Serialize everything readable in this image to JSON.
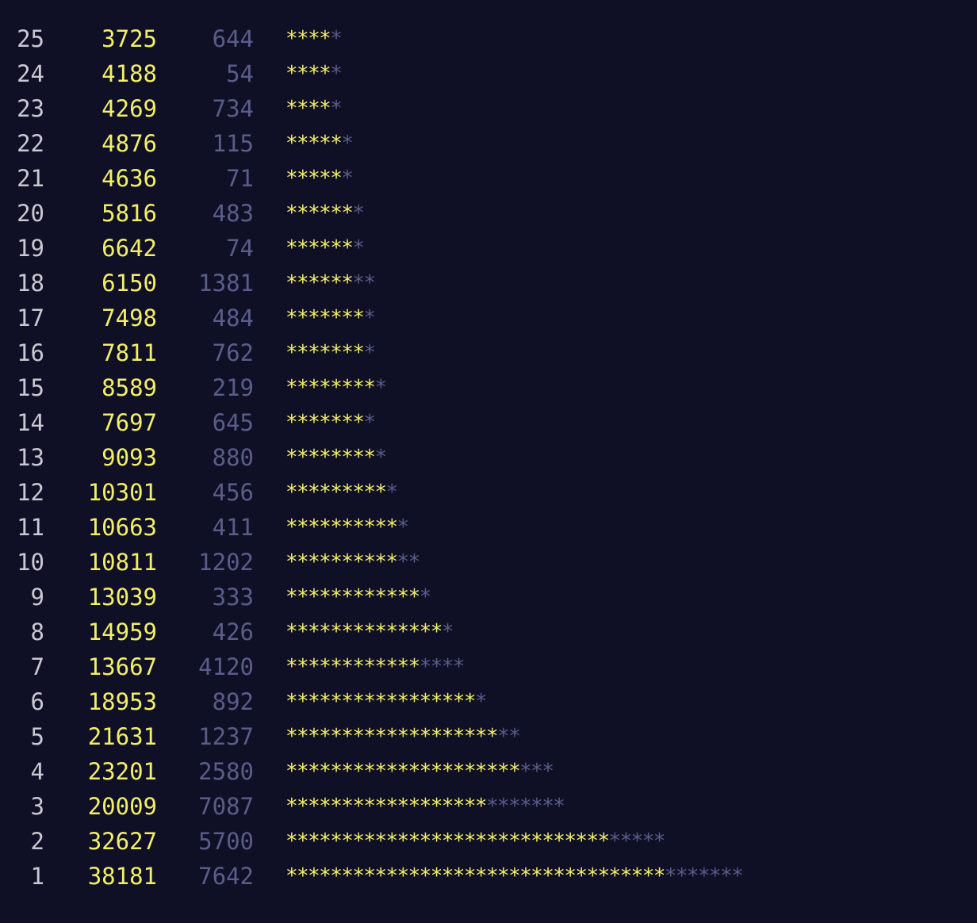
{
  "colors": {
    "background": "#0f1025",
    "rank": "#c9c9d3",
    "primary": "#f3ef6a",
    "secondary": "#5b5c8a"
  },
  "rows": [
    {
      "rank": "25",
      "primary": "3725",
      "secondary": "644",
      "primary_stars": 4,
      "secondary_stars": 1
    },
    {
      "rank": "24",
      "primary": "4188",
      "secondary": "54",
      "primary_stars": 4,
      "secondary_stars": 1
    },
    {
      "rank": "23",
      "primary": "4269",
      "secondary": "734",
      "primary_stars": 4,
      "secondary_stars": 1
    },
    {
      "rank": "22",
      "primary": "4876",
      "secondary": "115",
      "primary_stars": 5,
      "secondary_stars": 1
    },
    {
      "rank": "21",
      "primary": "4636",
      "secondary": "71",
      "primary_stars": 5,
      "secondary_stars": 1
    },
    {
      "rank": "20",
      "primary": "5816",
      "secondary": "483",
      "primary_stars": 6,
      "secondary_stars": 1
    },
    {
      "rank": "19",
      "primary": "6642",
      "secondary": "74",
      "primary_stars": 6,
      "secondary_stars": 1
    },
    {
      "rank": "18",
      "primary": "6150",
      "secondary": "1381",
      "primary_stars": 6,
      "secondary_stars": 2
    },
    {
      "rank": "17",
      "primary": "7498",
      "secondary": "484",
      "primary_stars": 7,
      "secondary_stars": 1
    },
    {
      "rank": "16",
      "primary": "7811",
      "secondary": "762",
      "primary_stars": 7,
      "secondary_stars": 1
    },
    {
      "rank": "15",
      "primary": "8589",
      "secondary": "219",
      "primary_stars": 8,
      "secondary_stars": 1
    },
    {
      "rank": "14",
      "primary": "7697",
      "secondary": "645",
      "primary_stars": 7,
      "secondary_stars": 1
    },
    {
      "rank": "13",
      "primary": "9093",
      "secondary": "880",
      "primary_stars": 8,
      "secondary_stars": 1
    },
    {
      "rank": "12",
      "primary": "10301",
      "secondary": "456",
      "primary_stars": 9,
      "secondary_stars": 1
    },
    {
      "rank": "11",
      "primary": "10663",
      "secondary": "411",
      "primary_stars": 10,
      "secondary_stars": 1
    },
    {
      "rank": "10",
      "primary": "10811",
      "secondary": "1202",
      "primary_stars": 10,
      "secondary_stars": 2
    },
    {
      "rank": "9",
      "primary": "13039",
      "secondary": "333",
      "primary_stars": 12,
      "secondary_stars": 1
    },
    {
      "rank": "8",
      "primary": "14959",
      "secondary": "426",
      "primary_stars": 14,
      "secondary_stars": 1
    },
    {
      "rank": "7",
      "primary": "13667",
      "secondary": "4120",
      "primary_stars": 12,
      "secondary_stars": 4
    },
    {
      "rank": "6",
      "primary": "18953",
      "secondary": "892",
      "primary_stars": 17,
      "secondary_stars": 1
    },
    {
      "rank": "5",
      "primary": "21631",
      "secondary": "1237",
      "primary_stars": 19,
      "secondary_stars": 2
    },
    {
      "rank": "4",
      "primary": "23201",
      "secondary": "2580",
      "primary_stars": 21,
      "secondary_stars": 3
    },
    {
      "rank": "3",
      "primary": "20009",
      "secondary": "7087",
      "primary_stars": 18,
      "secondary_stars": 7
    },
    {
      "rank": "2",
      "primary": "32627",
      "secondary": "5700",
      "primary_stars": 29,
      "secondary_stars": 5
    },
    {
      "rank": "1",
      "primary": "38181",
      "secondary": "7642",
      "primary_stars": 34,
      "secondary_stars": 7
    }
  ]
}
